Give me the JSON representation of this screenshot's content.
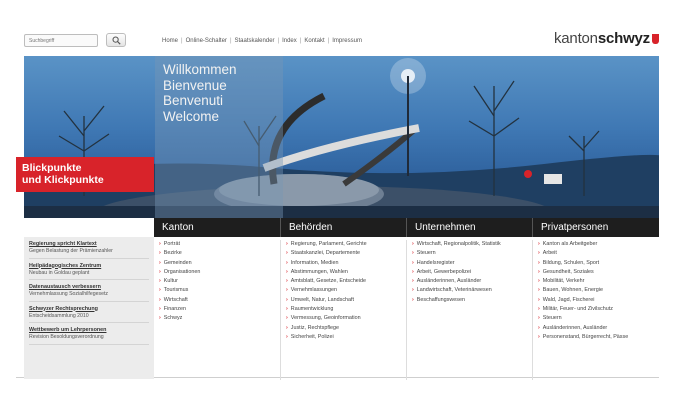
{
  "search": {
    "placeholder": "Suchbegriff"
  },
  "topnav": [
    "Home",
    "Online-Schalter",
    "Staatskalender",
    "Index",
    "Kontakt",
    "Impressum"
  ],
  "logo": {
    "light": "kanton",
    "bold": "schwyz"
  },
  "hero": {
    "welcome": [
      "Willkommen",
      "Bienvenue",
      "Benvenuti",
      "Welcome"
    ],
    "feature": [
      "Blickpunkte",
      "und Klickpunkte"
    ]
  },
  "categories": [
    "Kanton",
    "Behörden",
    "Unternehmen",
    "Privatpersonen"
  ],
  "news": [
    {
      "title": "Regierung spricht Klartext",
      "text": "Gegen Belastung der Prämienzahler"
    },
    {
      "title": "Heilpädagogisches Zentrum",
      "text": "Neubau in Goldau geplant"
    },
    {
      "title": "Datenaustausch verbessern",
      "text": "Vernehmlassung Sozialhilfegesetz"
    },
    {
      "title": "Schwyzer Rechtsprechung",
      "text": "Entscheidsammlung 2010"
    },
    {
      "title": "Wettbewerb um Lehrpersonen",
      "text": "Revision Besoldungsverordnung"
    }
  ],
  "columns": {
    "kanton": [
      "Porträt",
      "Bezirke",
      "Gemeinden",
      "Organisationen",
      "Kultur",
      "Tourismus",
      "Wirtschaft",
      "Finanzen",
      "Schwyz"
    ],
    "behoerden": [
      "Regierung, Parlament, Gerichte",
      "Staatskanzlei, Departemente",
      "Information, Medien",
      "Abstimmungen, Wahlen",
      "Amtsblatt, Gesetze, Entscheide",
      "Vernehmlassungen",
      "Umwelt, Natur, Landschaft",
      "Raumentwicklung",
      "Vermessung, Geoinformation",
      "Justiz, Rechtspflege",
      "Sicherheit, Polizei"
    ],
    "unternehmen": [
      "Wirtschaft, Regionalpolitik, Statistik",
      "Steuern",
      "Handelsregister",
      "Arbeit, Gewerbepolizei",
      "Ausländerinnen, Ausländer",
      "Landwirtschaft, Veterinärwesen",
      "Beschaffungswesen"
    ],
    "privatpersonen": [
      "Kanton als Arbeitgeber",
      "Arbeit",
      "Bildung, Schulen, Sport",
      "Gesundheit, Soziales",
      "Mobilität, Verkehr",
      "Bauen, Wohnen, Energie",
      "Wald, Jagd, Fischerei",
      "Militär, Feuer- und Zivilschutz",
      "Steuern",
      "Ausländerinnen, Ausländer",
      "Personenstand, Bürgerrecht, Pässe"
    ]
  },
  "colors": {
    "accent": "#d8232a",
    "bar": "#1e1e1e"
  }
}
